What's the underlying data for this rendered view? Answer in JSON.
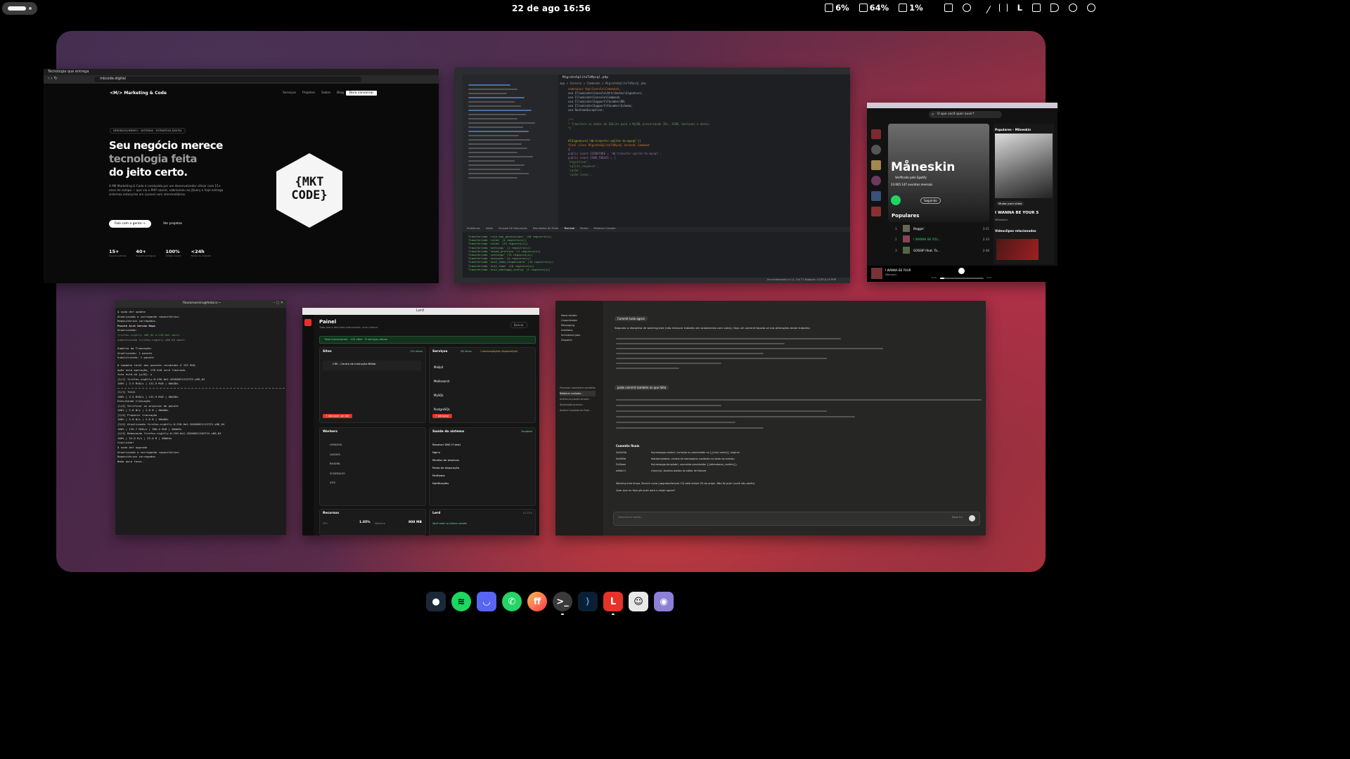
{
  "topbar": {
    "clock": "22 de ago  16:56",
    "cpu": "6%",
    "battery": "64%",
    "disk": "1%",
    "lang": "L"
  },
  "browser": {
    "tab": "Tecnologia que entrega",
    "url": "mkcode.digital",
    "brand": "Marketing & Code",
    "nav": [
      "Serviços",
      "Projetos",
      "Sobre",
      "Blog"
    ],
    "cta_nav": "Bora conversar",
    "badge": "DESENVOLVIMENTO · SISTEMAS · ESTRATÉGIA DIGITAL",
    "headline1": "Seu negócio merece",
    "headline2": "tecnologia feita",
    "headline3": "do jeito certo.",
    "body": "A MK Marketing & Code é conduzida por um desenvolvedor sênior com 15+ anos de campo — que viu o PHP nascer, sobreviveu ao jQuery e hoje entrega sistemas enterprise em Laravel sem intermediários.",
    "cta_primary": "Fale com a gente →",
    "cta_secondary": "Ver projetos",
    "logo_text1": "{MKT",
    "logo_text2": "CODE}",
    "stats": [
      {
        "value": "15+",
        "label": "Anos de estrada"
      },
      {
        "value": "40+",
        "label": "Projetos entregues"
      },
      {
        "value": "100%",
        "label": "Código próprio"
      },
      {
        "value": "<24h",
        "label": "Tempo de resposta"
      }
    ]
  },
  "ide": {
    "tab": "MigrateSqliteToMysql.php",
    "breadcrumb": "app > Console > Commands > MigrateSqliteToMysql.php",
    "code": [
      "namespace App\\Console\\Commands;",
      "use Illuminate\\Console\\Attributes\\Signature;",
      "use Illuminate\\Console\\Command;",
      "use Illuminate\\Support\\Facades\\DB;",
      "use Illuminate\\Support\\Facades\\Schema;",
      "use RuntimeException;",
      "/**",
      " * Transfere os dados do SQLite para o MySQL preservando IDs, JSON, booleans e datas.",
      " */",
      "#[Signature('db:transfer-sqlite-to-mysql')]",
      "final class MigrateSqliteToMysql extends Command",
      "{",
      "    public const SIGNATURE = 'db:transfer-sqlite-to-mysql';",
      "    public const JSON_TABLES = [",
      "        'migrations',",
      "        'sqlite_sequence',",
      "        'cache',",
      "        'cache_locks',"
    ],
    "terminal_tabs": [
      "Problemas",
      "Saída",
      "Console De Depuração",
      "Resultados Do Teste",
      "Terminal",
      "Portas",
      "Postman Console"
    ],
    "terminal": [
      "Transferindo 'role_has_permissions' (18 registro(s))",
      "Transferindo 'roles' (4 registro(s))",
      "Transferindo 'sites' (11 registro(s))",
      "Transferindo 'settings' (1 registro(s))",
      "Transferindo 'saved_profiles' (1 registro(s))",
      "Transferindo 'settings' (72 registro(s))",
      "Transferindo 'sessions' (4 registro(s))",
      "Transferindo 'unit_team_responsible' (15 registro(s))",
      "Transferindo 'unit_team' (10 registro(s))",
      "Transferindo 'unit_whatsapp_config' (1 registro(s))"
    ],
    "status": "Em andamento  Ln 11, Col 77  Espaços: 4  UTF-8  LF  PHP"
  },
  "spotify": {
    "search": "O que você quer ouvir?",
    "artist": "Måneskin",
    "verified": "Verificado pela Spotify",
    "listeners": "23.665.147 ouvintes mensais",
    "following": "Seguindo",
    "section": "Populares",
    "tracks": [
      {
        "n": "1",
        "title": "Beggin'",
        "dur": "3:31"
      },
      {
        "n": "2",
        "title": "I WANNA BE YOU...",
        "dur": "2:33"
      },
      {
        "n": "3",
        "title": "GOSSIP (feat. To...",
        "dur": "2:48"
      }
    ],
    "side_title": "Populares – Måneskin",
    "side_song": "I WANNA BE YOUR S",
    "side_artist": "Måneskin",
    "side_btn": "Mudar para vídeo",
    "side_related": "Videoclipes relacionados",
    "now_playing": "I WANNA BE YOUR",
    "now_artist": "Måneskin",
    "time_start": "0:15",
    "time_end": "2:53",
    "progress": 0.09
  },
  "terminal": {
    "title": "flaviomoreira@fedora:~",
    "lines": [
      "$ sudo dnf update",
      "Atualizando e carregando repositórios:",
      "Repositórios carregados.",
      "Pacote                     Arch    Versão          Repo",
      "Atualizando:",
      " firefox-nightly           x86_64  0:150.0a1      mozil",
      "substituindo firefox-nightly x86_64                 mozil",
      "Sumário da Transação:",
      " Atualizando:          1 pacote",
      " Substituindo:         1 pacote",
      "O tamanho total dos pacotes recebidos é 132 MiB.",
      "Após esta operação, 178 KiB será liberado.",
      "Isto está ok [y/N]: y",
      "[1/1] firefox-nightly-0:150.0a1-20260821213723.x86_64",
      "100% |   3.5 MiB/s | 131.9 MiB |  00m38s",
      "[1/1] Total",
      "100% |   3.5 MiB/s | 131.9 MiB |  00m38s",
      "Executando transação",
      "[1/4] Verificar os arquivos do pacote",
      "100% |   2.0  B/s  |   1.0  B  |  00m00s",
      "[2/4] Preparar transação",
      "100% |   3.0  B/s  |   2.0  B  |  00m00s",
      "[3/4] Atualizando firefox-nightly-0:150.0a1-20260821213723.x86_64",
      "100% | 135.7 MiB/s | 380.4 MiB |  00m03s",
      "[4/4] Removendo firefox-nightly-0:150.0a1-20260821184724.x86_64",
      "100% |   34.0  B/s |  25.0  B  |  00m04s",
      "Concluído!",
      "$ sudo dnf upgrade",
      "Atualizando e carregando repositórios:",
      "Repositórios carregados.",
      "Nada para fazer."
    ]
  },
  "panel": {
    "window_title": "Lerd",
    "title": "Painel",
    "subtitle": "Tudo que o lerd está executando, num relance",
    "search": "Buscar",
    "alert": "Tudo funcionando · 132 sites · 9 serviços ativos",
    "sites_title": "Sites",
    "sites_badge": "132 ativos",
    "site_name": "CIM – Centro de Instrução Militar",
    "services_title": "Serviços",
    "services_badge": "9/9 ativos",
    "services_warn": "1 atualização(ões) disponível(eis)",
    "services": [
      "Mailpit",
      "Meilisearch",
      "MySQL",
      "PostgreSQL"
    ],
    "add_site": "+ Adicionar um site",
    "add_service": "+ Adicionar",
    "workers_title": "Workers",
    "workers": [
      "HORIZON",
      "QUEUES",
      "REVERB",
      "SCHEDULES",
      "VITE"
    ],
    "health_title": "Saúde do sistema",
    "health_badge": "Saudável",
    "health": [
      "Resolver DNS (*.test)",
      "Nginx",
      "Monitor de arquivos",
      "Ponto de depuração",
      "Perfilador",
      "Notificações"
    ],
    "resources_title": "Recursos",
    "cpu_label": "CPU",
    "cpu_value": "1.05%",
    "mem_label": "Memória",
    "mem_value": "808 MB",
    "lerd_title": "Lerd",
    "lerd_version": "v1.19.0",
    "lerd_status": "Você está na última versão"
  },
  "claude": {
    "sidebar": [
      "Nova sessão",
      "Capacidades",
      "Messaging",
      "Artefatos",
      "Scheduled jobs",
      "Dispatch"
    ],
    "threads": [
      "Processar comentário pendente",
      "Refatorar contador...",
      "Análise do pacote laravel/...",
      "Atualização gradual...",
      "Análise Completa do Proje..."
    ],
    "msg1": "Commit tudo agora",
    "body1": "Segundo a disciplina de working-tree (não misturar trabalho em andamento com outro), faço um commit focado só nas alterações deste trabalho.",
    "msg2": "pode commit também os que falta",
    "table_title": "Commits finais",
    "table": [
      {
        "commit": "3a1b05b",
        "desc": "fix(message-center): correção no placeholder no {{clinic.name}} original"
      },
      {
        "commit": "0e4f83d",
        "desc": "feat(templates): central de mensagens (variáveis no texto do evento)"
      },
      {
        "commit": "f2d9aee",
        "desc": "fix(message-template): normaliza placeholder {{attendance_confirm}}"
      },
      {
        "commit": "a9b8c1f",
        "desc": "chore(ui): atualiza botões do editor de feature"
      }
    ],
    "foot": "Working tree limpa. Branch nova (upgrade/laravel-13) está ahead 29 do origin. Não fiz push (você não pediu).",
    "question": "Quer que eu faça git push para o origin agora?",
    "input": "Descreva a tarefa...",
    "model": "Opus 4.1"
  },
  "dock": [
    "Steam",
    "Spotify",
    "Discord",
    "WhatsApp",
    "Firefox",
    "Terminal",
    "VS Code",
    "Lerd",
    "Ghostty",
    "Screenshot"
  ]
}
